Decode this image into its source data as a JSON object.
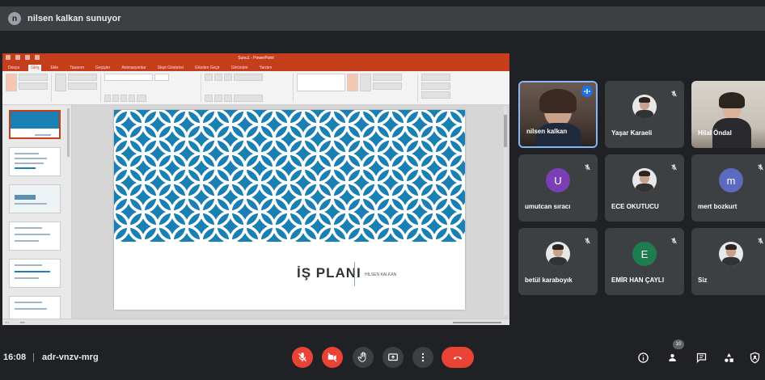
{
  "presenter": {
    "avatar_initial": "n",
    "text": "nilsen kalkan sunuyor"
  },
  "ppt": {
    "title": "Sunu1 - PowerPoint",
    "tabs": [
      "Dosya",
      "Giriş",
      "Ekle",
      "Tasarım",
      "Geçişler",
      "Animasyonlar",
      "Slayt Gösterisi",
      "Gözden Geçir",
      "Görünüm",
      "Yardım"
    ],
    "active_tab": "Giriş",
    "slide_title": "İŞ PLANI",
    "slide_author": "HİLSEN KALKAN"
  },
  "participants": [
    {
      "name": "nilsen kalkan",
      "type": "video",
      "speaking": true
    },
    {
      "name": "Yaşar Karaeli",
      "type": "avatar-photo",
      "muted": true
    },
    {
      "name": "Hilal Öndal",
      "type": "video",
      "muted": false
    },
    {
      "name": "umutcan sıracı",
      "type": "letter",
      "letter": "U",
      "color": "#7b3fb5",
      "muted": true
    },
    {
      "name": "ECE OKUTUCU",
      "type": "avatar-photo",
      "muted": true
    },
    {
      "name": "mert bozkurt",
      "type": "letter",
      "letter": "m",
      "color": "#5c6bc0",
      "muted": true
    },
    {
      "name": "betül karaboyık",
      "type": "avatar-photo",
      "muted": true
    },
    {
      "name": "EMİR HAN ÇAYLI",
      "type": "letter",
      "letter": "E",
      "color": "#1e7d4f",
      "muted": true
    },
    {
      "name": "Siz",
      "type": "avatar-photo",
      "muted": true
    }
  ],
  "bottom": {
    "time": "16:08",
    "separator": "|",
    "meeting_code": "adr-vnzv-mrg",
    "people_count": "10"
  },
  "colors": {
    "bg": "#202124",
    "tile": "#3c4043",
    "danger": "#ea4335",
    "accent": "#1a73e8",
    "ppt_brand": "#c43e1c",
    "slide_pattern": "#1a7fb3"
  },
  "icons": {
    "mic_off": "mic-off-icon",
    "cam_off": "camera-off-icon",
    "raise_hand": "raise-hand-icon",
    "present": "present-screen-icon",
    "more": "more-vert-icon",
    "hang_up": "hang-up-icon",
    "info": "info-icon",
    "people": "people-icon",
    "chat": "chat-icon",
    "activities": "activities-icon",
    "host": "host-controls-icon"
  }
}
